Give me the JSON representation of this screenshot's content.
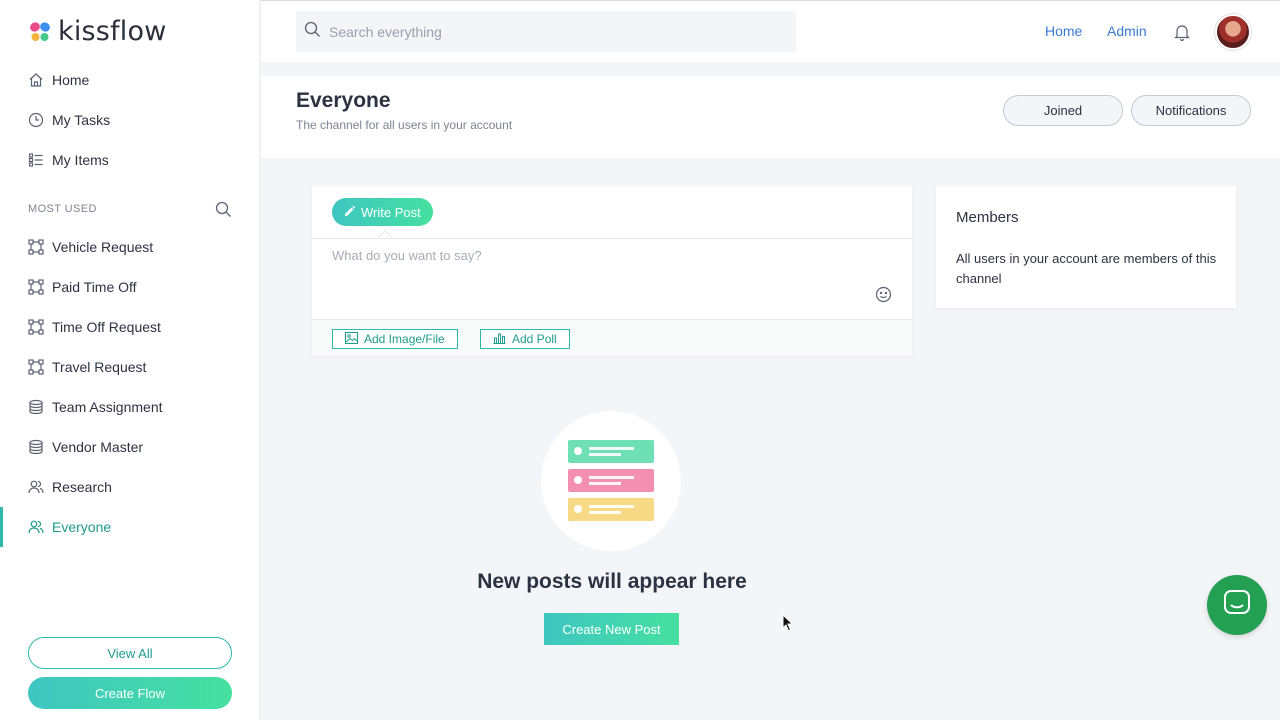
{
  "app": {
    "logo_text": "kissflow"
  },
  "sidebar": {
    "nav": [
      {
        "label": "Home",
        "icon": "home-icon"
      },
      {
        "label": "My Tasks",
        "icon": "clock-icon"
      },
      {
        "label": "My Items",
        "icon": "list-icon"
      }
    ],
    "section_label": "MOST USED",
    "items": [
      {
        "label": "Vehicle Request",
        "icon": "flow-icon"
      },
      {
        "label": "Paid Time Off",
        "icon": "flow-icon"
      },
      {
        "label": "Time Off Request",
        "icon": "flow-icon"
      },
      {
        "label": "Travel Request",
        "icon": "flow-icon"
      },
      {
        "label": "Team Assignment",
        "icon": "database-icon"
      },
      {
        "label": "Vendor Master",
        "icon": "database-icon"
      },
      {
        "label": "Research",
        "icon": "users-icon"
      },
      {
        "label": "Everyone",
        "icon": "users-icon",
        "active": true
      }
    ],
    "view_all_label": "View All",
    "create_flow_label": "Create Flow"
  },
  "topbar": {
    "search_placeholder": "Search everything",
    "links": [
      "Home",
      "Admin"
    ]
  },
  "channel": {
    "title": "Everyone",
    "subtitle": "The channel for all users in your account",
    "joined_label": "Joined",
    "notifications_label": "Notifications"
  },
  "composer": {
    "tab_label": "Write Post",
    "placeholder": "What do you want to say?",
    "add_image_label": "Add Image/File",
    "add_poll_label": "Add Poll"
  },
  "members": {
    "title": "Members",
    "text": "All users in your account are members of this channel"
  },
  "empty_state": {
    "title": "New posts will appear here",
    "button_label": "Create New Post"
  },
  "colors": {
    "accent": "#2fb8a8",
    "link": "#3a7bd5",
    "chat": "#23a052",
    "card_green": "#6fe0b5",
    "card_pink": "#f38fb0",
    "card_yellow": "#f8da86"
  }
}
